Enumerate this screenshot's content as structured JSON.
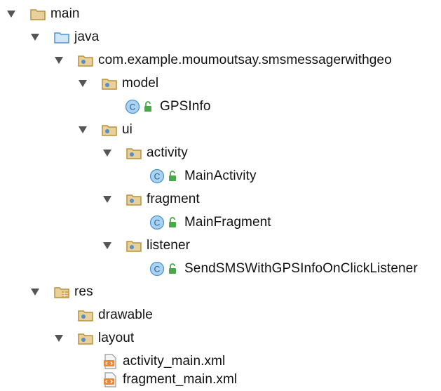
{
  "tree": {
    "main": "main",
    "java": "java",
    "package": "com.example.moumoutsay.smsmessagerwithgeo",
    "model": "model",
    "gpsinfo": "GPSInfo",
    "ui": "ui",
    "activity": "activity",
    "main_activity": "MainActivity",
    "fragment": "fragment",
    "main_fragment": "MainFragment",
    "listener": "listener",
    "send_listener": "SendSMSWithGPSInfoOnClickListener",
    "res": "res",
    "drawable": "drawable",
    "layout": "layout",
    "activity_main_xml": "activity_main.xml",
    "fragment_main_xml": "fragment_main.xml",
    "class_letter": "C"
  },
  "colors": {
    "folder_tan": "#d9b86a",
    "folder_dark": "#b8923e",
    "java_blue": "#6bb0e0",
    "pkg_dot": "#5a8fc4",
    "class_circle": "#7fb6e8",
    "lock_green": "#4aa84a",
    "arrow": "#555555",
    "xml_orange": "#e68a3a"
  }
}
